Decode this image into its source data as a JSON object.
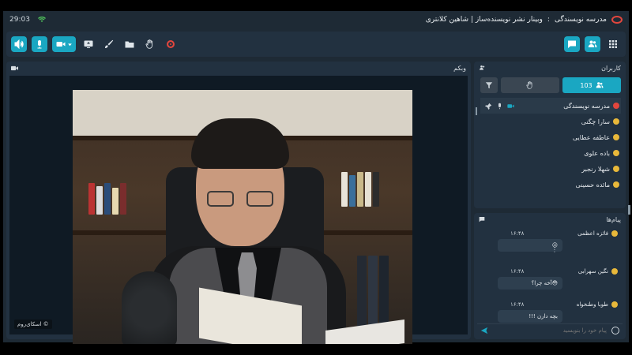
{
  "status_bar": {
    "time": "29:03",
    "app_name": "مدرسه نویسندگی",
    "separator": ":",
    "session_title": "وبینار نشر نویسنده‌ساز | شاهین کلانتری"
  },
  "toolbar": {
    "left_icons": [
      "speaker-icon",
      "microphone-icon",
      "camera-icon",
      "share-screen-icon",
      "brush-icon",
      "folder-icon",
      "hand-icon",
      "record-icon"
    ],
    "right_icons": [
      "chat-icon",
      "users-icon",
      "grid-icon"
    ],
    "accent_color": "#1aa7c2"
  },
  "webcam": {
    "title": "وبکم",
    "watermark": "اسکای‌روم ©"
  },
  "users": {
    "title": "کاربران",
    "count": "103",
    "list": [
      {
        "name": "مدرسه نویسندگی",
        "role": "host"
      },
      {
        "name": "سارا چگنی",
        "role": "user"
      },
      {
        "name": "عاطفه عطایی",
        "role": "user"
      },
      {
        "name": "باده علوی",
        "role": "user"
      },
      {
        "name": "شهلا رنجبر",
        "role": "user"
      },
      {
        "name": "مائده حسینی",
        "role": "user"
      }
    ]
  },
  "chat": {
    "title": "پیام‌ها",
    "messages": [
      {
        "author": "فائزه اعظمی",
        "time": "۱۶:۴۸",
        "text": "😐"
      },
      {
        "author": "نگین سهرابی",
        "time": "۱۶:۴۸",
        "text": "آخه چرا؟😳"
      },
      {
        "author": "طوبا وطنخواه",
        "time": "۱۶:۴۸",
        "text": "!!! بچه دارن"
      }
    ],
    "input_placeholder": "پیام خود را بنویسید"
  }
}
